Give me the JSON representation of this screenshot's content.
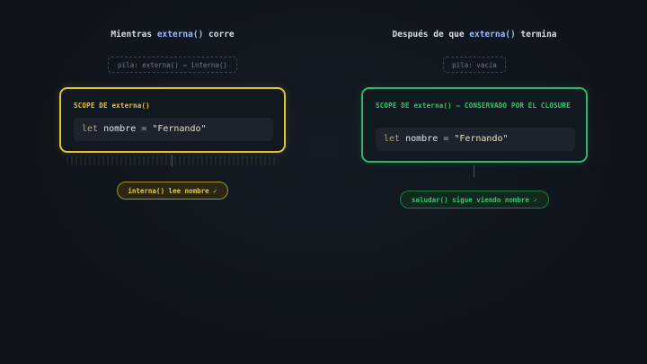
{
  "left": {
    "heading_prefix": "Mientras ",
    "heading_kw": "externa()",
    "heading_suffix": " corre",
    "stack": "pila: externa() → interna()",
    "scope_label": "SCOPE DE externa()",
    "code": {
      "kw": "let",
      "id": "nombre",
      "op": "=",
      "str": "\"Fernando\""
    },
    "result": "interna() lee nombre ✓"
  },
  "right": {
    "heading_prefix": "Después de que ",
    "heading_kw": "externa()",
    "heading_suffix": " termina",
    "stack": "pila: vacía",
    "scope_label": "SCOPE DE externa() — CONSERVADO POR EL CLOSURE",
    "code": {
      "kw": "let",
      "id": "nombre",
      "op": "=",
      "str": "\"Fernando\""
    },
    "result": "saludar() sigue viendo nombre ✓"
  },
  "colors": {
    "active": "#e2c32a",
    "closure": "#2fb765",
    "background": "#0f141b"
  }
}
